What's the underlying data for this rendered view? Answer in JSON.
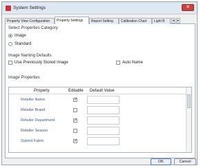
{
  "window": {
    "title": "System Settings",
    "close_glyph": "✕"
  },
  "tabs": [
    {
      "label": "Property View Configuration",
      "active": false
    },
    {
      "label": "Property Settings",
      "active": true
    },
    {
      "label": "Report Setting",
      "active": false
    },
    {
      "label": "Calibration Chart",
      "active": false
    },
    {
      "label": "Light B",
      "active": false
    }
  ],
  "tab_scroll": {
    "left_glyph": "◄",
    "right_glyph": "►"
  },
  "properties_category": {
    "label": "Select Properties Category",
    "options": [
      {
        "label": "Image",
        "selected": true
      },
      {
        "label": "Standard",
        "selected": false
      }
    ]
  },
  "naming_defaults": {
    "label": "Image Naming Defaults",
    "use_previously_stored": {
      "label": "Use Previously Stored Image",
      "checked": false
    },
    "auto_name": {
      "label": "Auto Name",
      "checked": false
    }
  },
  "image_properties": {
    "label": "Image Properties",
    "columns": [
      "Property",
      "Editable",
      "Default Value"
    ],
    "rows": [
      {
        "property": "Retailer Name",
        "editable": true,
        "default_value": ""
      },
      {
        "property": "Retailer Brand",
        "editable": false,
        "default_value": ""
      },
      {
        "property": "Retailer Department",
        "editable": true,
        "default_value": ""
      },
      {
        "property": "Retailer Season",
        "editable": false,
        "default_value": ""
      },
      {
        "property": "Submit Fabric",
        "editable": true,
        "default_value": ""
      }
    ]
  },
  "check_glyph": "✓",
  "footer": {
    "ok_label": "OK",
    "cancel_label": "Cancel"
  }
}
